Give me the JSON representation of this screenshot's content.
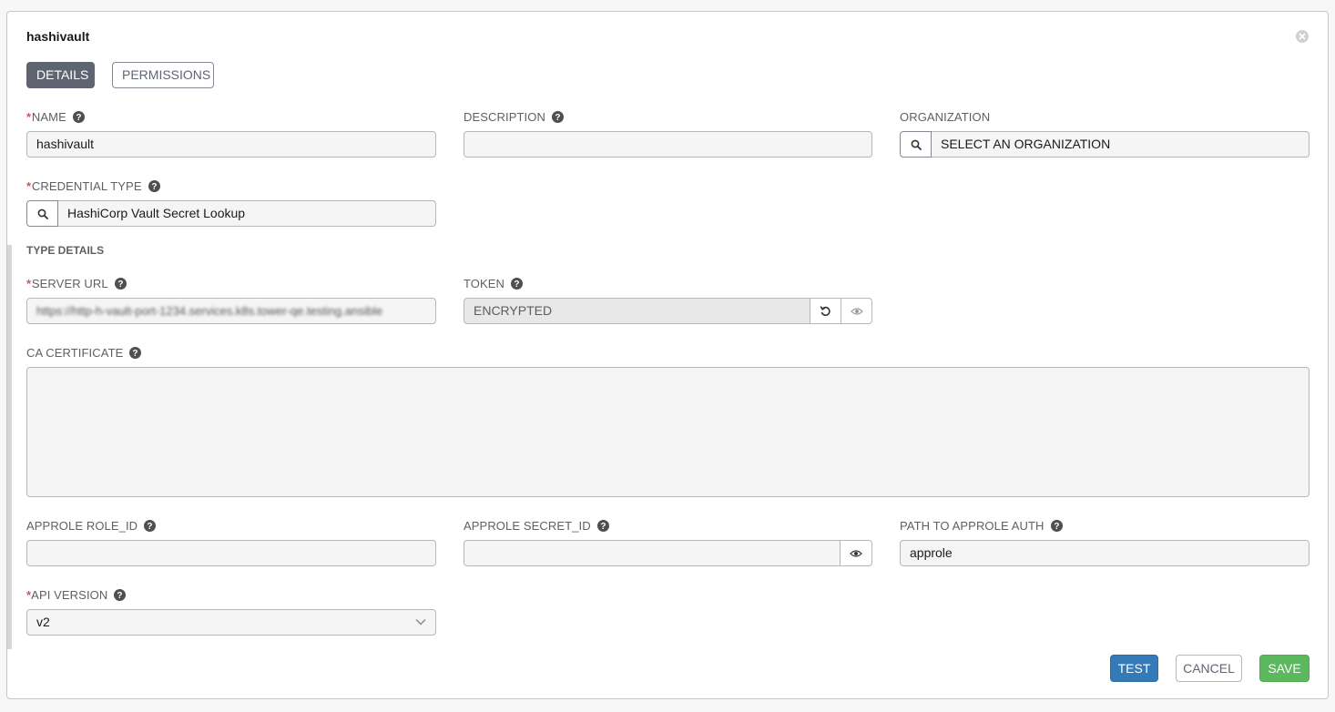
{
  "form": {
    "title": "hashivault",
    "tabs": [
      "DETAILS",
      "PERMISSIONS"
    ]
  },
  "fields": {
    "name": {
      "label": "NAME",
      "value": "hashivault",
      "required": true
    },
    "description": {
      "label": "DESCRIPTION",
      "value": ""
    },
    "organization": {
      "label": "ORGANIZATION",
      "placeholder": "SELECT AN ORGANIZATION"
    },
    "credential_type": {
      "label": "CREDENTIAL TYPE",
      "value": "HashiCorp Vault Secret Lookup",
      "required": true
    },
    "type_details": {
      "label": "TYPE DETAILS"
    },
    "server_url": {
      "label": "SERVER URL",
      "value": "https://http-h-vault-port-1234.services.k8s.tower-qe.testing.ansible",
      "required": true
    },
    "token": {
      "label": "TOKEN",
      "value": "ENCRYPTED"
    },
    "ca_certificate": {
      "label": "CA CERTIFICATE",
      "value": ""
    },
    "approle_role_id": {
      "label": "APPROLE ROLE_ID",
      "value": ""
    },
    "approle_secret_id": {
      "label": "APPROLE SECRET_ID",
      "value": ""
    },
    "path_to_approle_auth": {
      "label": "PATH TO APPROLE AUTH",
      "value": "approle"
    },
    "api_version": {
      "label": "API VERSION",
      "value": "v2",
      "required": true
    }
  },
  "actions": {
    "test": "TEST",
    "cancel": "CANCEL",
    "save": "SAVE"
  },
  "colors": {
    "test": "#337ab7",
    "save": "#5cb85c",
    "active_tab": "#5f6570",
    "required": "#d9534f"
  }
}
